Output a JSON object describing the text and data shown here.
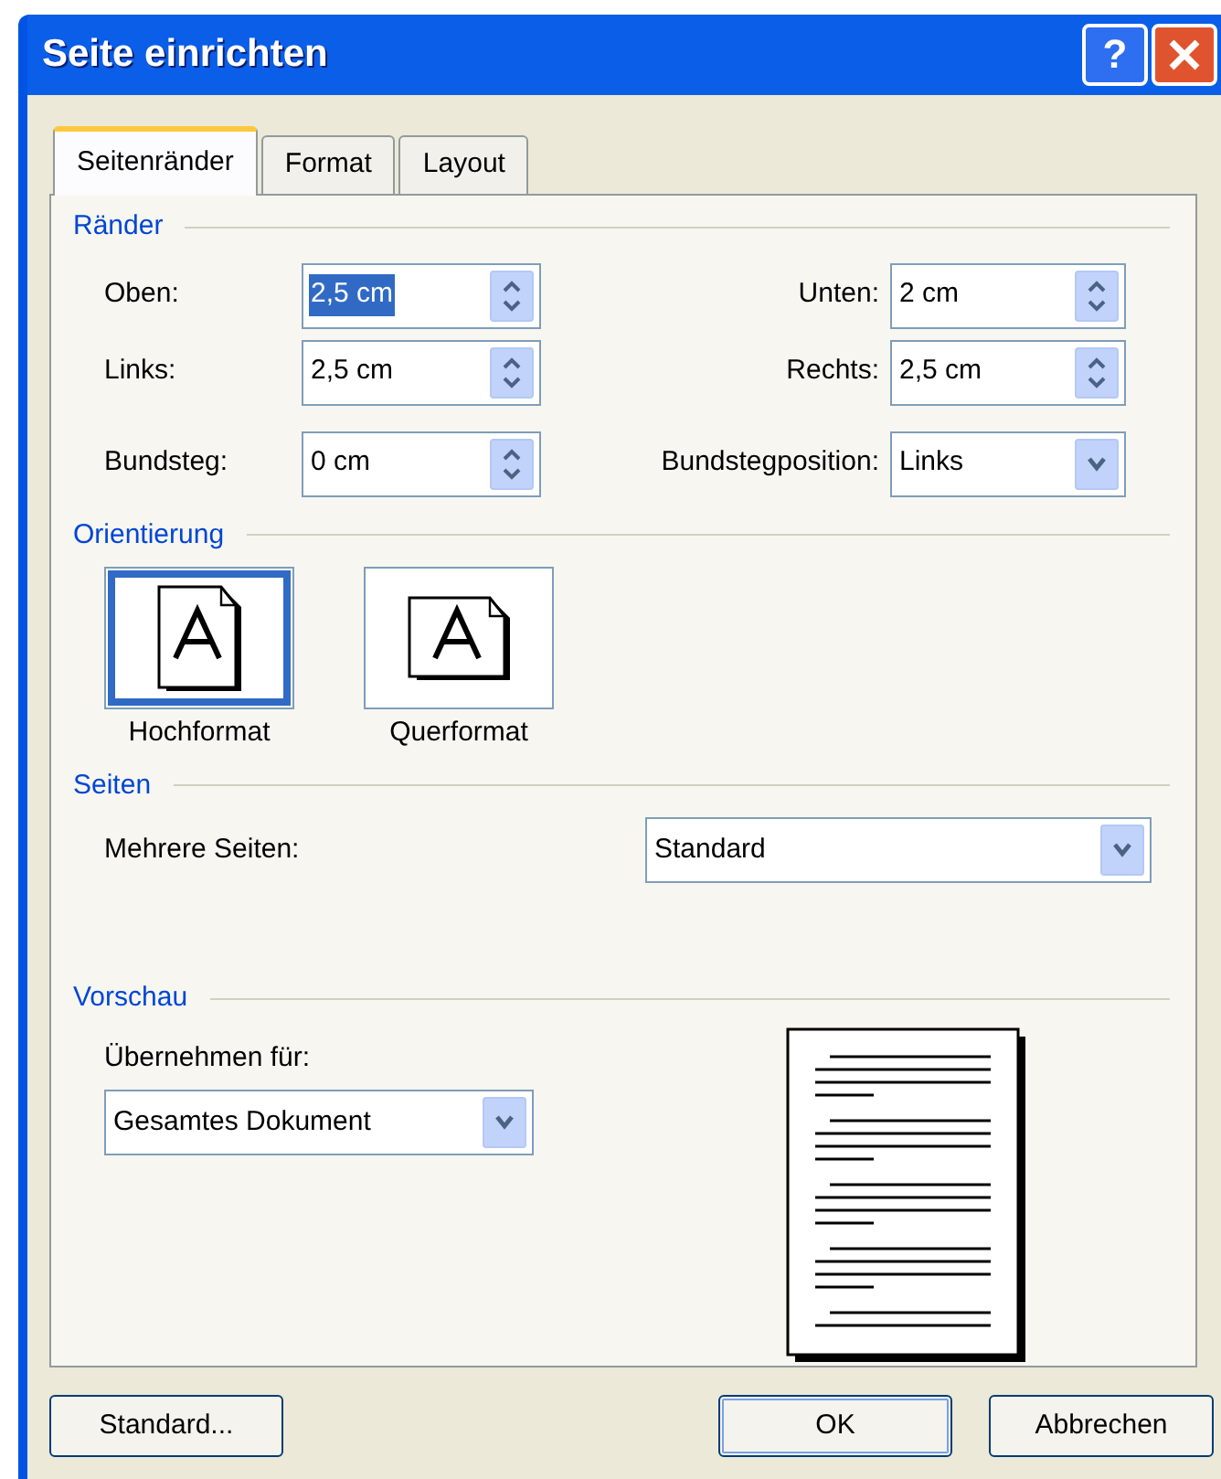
{
  "window": {
    "title": "Seite einrichten",
    "help": "?"
  },
  "tabs": [
    {
      "label": "Seitenränder",
      "selected": true
    },
    {
      "label": "Format",
      "selected": false
    },
    {
      "label": "Layout",
      "selected": false
    }
  ],
  "margins": {
    "heading": "Ränder",
    "fields": [
      {
        "label": "Oben:",
        "value": "2,5 cm",
        "kind": "spin",
        "highlighted": true
      },
      {
        "label": "Unten:",
        "value": "2 cm",
        "kind": "spin",
        "highlighted": false
      },
      {
        "label": "Links:",
        "value": "2,5 cm",
        "kind": "spin",
        "highlighted": false
      },
      {
        "label": "Rechts:",
        "value": "2,5 cm",
        "kind": "spin",
        "highlighted": false
      },
      {
        "label": "Bundsteg:",
        "value": "0 cm",
        "kind": "spin",
        "highlighted": false
      },
      {
        "label": "Bundstegposition:",
        "value": "Links",
        "kind": "dropdown",
        "highlighted": false
      }
    ]
  },
  "orientation": {
    "heading": "Orientierung",
    "options": [
      {
        "label": "Hochformat",
        "kind": "portrait",
        "selected": true
      },
      {
        "label": "Querformat",
        "kind": "landscape",
        "selected": false
      }
    ]
  },
  "pages": {
    "heading": "Seiten",
    "label": "Mehrere Seiten:",
    "value": "Standard"
  },
  "preview": {
    "heading": "Vorschau",
    "label": "Übernehmen für:",
    "value": "Gesamtes Dokument"
  },
  "buttons": [
    {
      "label": "Standard...",
      "kind": "left"
    },
    {
      "label": "OK",
      "kind": "default"
    },
    {
      "label": "Abbrechen",
      "kind": "right"
    }
  ]
}
